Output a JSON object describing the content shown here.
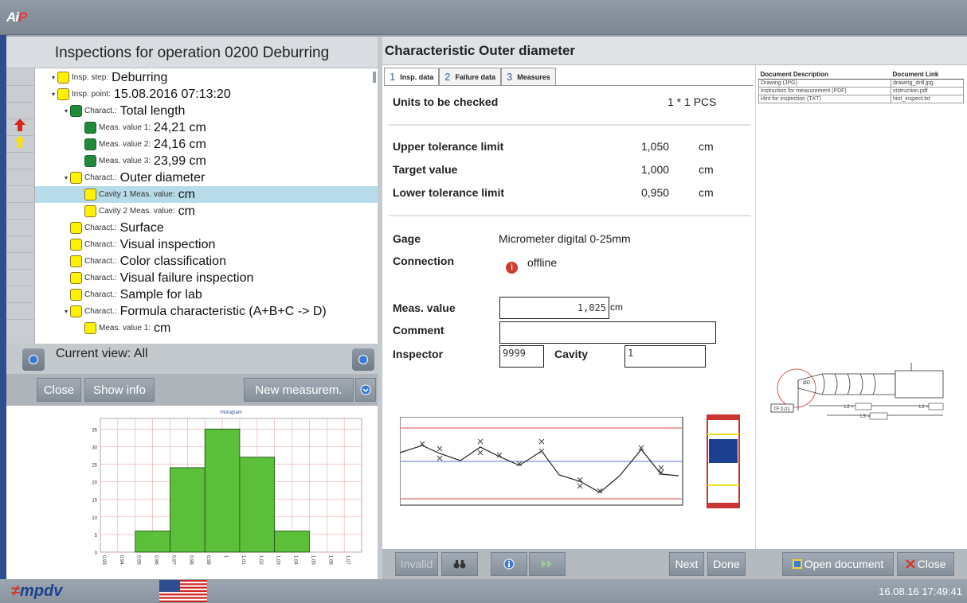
{
  "app": {
    "logo_a": "A",
    "logo_i": "i",
    "logo_p": "P"
  },
  "left": {
    "title": "Inspections for operation 0200 Deburring",
    "tree": [
      {
        "label": "Insp. step:",
        "value": "Deburring"
      },
      {
        "label": "Insp. point:",
        "value": "15.08.2016 07:13:20"
      },
      {
        "label": "Charact.:",
        "value": "Total length"
      },
      {
        "label": "Meas. value 1:",
        "value": "24,21 cm"
      },
      {
        "label": "Meas. value 2:",
        "value": "24,16 cm"
      },
      {
        "label": "Meas. value 3:",
        "value": "23,99 cm"
      },
      {
        "label": "Charact.:",
        "value": "Outer diameter"
      },
      {
        "label": "Cavity 1 Meas. value:",
        "value": "cm"
      },
      {
        "label": "Cavity 2 Meas. value:",
        "value": "cm"
      },
      {
        "label": "Charact.:",
        "value": "Surface"
      },
      {
        "label": "Charact.:",
        "value": "Visual inspection"
      },
      {
        "label": "Charact.:",
        "value": "Color classification"
      },
      {
        "label": "Charact.:",
        "value": "Visual failure inspection"
      },
      {
        "label": "Charact.:",
        "value": "Sample for lab"
      },
      {
        "label": "Charact.:",
        "value": "Formula characteristic (A+B+C -> D)"
      },
      {
        "label": "Meas. value 1:",
        "value": "cm"
      }
    ],
    "current_view": "Current view: All",
    "buttons": {
      "close": "Close",
      "show_info": "Show info",
      "new_measurement": "New measurem."
    }
  },
  "histogram": {
    "title": "Histogram"
  },
  "chart_data": {
    "type": "bar",
    "title": "Histogram",
    "categories": [
      "0,93",
      "0,94",
      "0,95",
      "0,96",
      "0,97",
      "0,98",
      "0,99",
      "1",
      "1,01",
      "1,02",
      "1,03",
      "1,04",
      "1,05",
      "1,06",
      "1,07"
    ],
    "values": [
      0,
      0,
      0,
      6,
      0,
      24,
      0,
      35,
      0,
      27,
      0,
      6,
      0,
      0,
      0
    ],
    "yticks": [
      "0",
      "5",
      "10",
      "15",
      "20",
      "25",
      "30",
      "35"
    ],
    "ylim": [
      0,
      38
    ],
    "grid": true,
    "bar_color": "#5bbf3a"
  },
  "right": {
    "title": "Characteristic Outer diameter",
    "tabs": [
      {
        "num": "1",
        "label": "Insp. data"
      },
      {
        "num": "2",
        "label": "Failure data"
      },
      {
        "num": "3",
        "label": "Measures"
      }
    ],
    "units_label": "Units to be checked",
    "units_value": "1 * 1 PCS",
    "limits": [
      {
        "label": "Upper tolerance limit",
        "value": "1,050",
        "unit": "cm"
      },
      {
        "label": "Target value",
        "value": "1,000",
        "unit": "cm"
      },
      {
        "label": "Lower tolerance limit",
        "value": "0,950",
        "unit": "cm"
      }
    ],
    "gage_label": "Gage",
    "gage_value": "Micrometer digital 0-25mm",
    "connection_label": "Connection",
    "connection_value": "offline",
    "meas_label": "Meas. value",
    "meas_value": "1,025",
    "meas_unit": "cm",
    "comment_label": "Comment",
    "comment_value": "",
    "inspector_label": "Inspector",
    "inspector_value": "9999",
    "cavity_label": "Cavity",
    "cavity_value": "1",
    "documents": {
      "headers": [
        "Document Description",
        "Document Link"
      ],
      "rows": [
        [
          "Drawing (JPG)",
          "drawing_drill.jpg"
        ],
        [
          "Instruction for measurement (PDF)",
          "instruction.pdf"
        ],
        [
          "Hint for inspection (TXT)",
          "hint_inspect.txt"
        ]
      ]
    },
    "drawing_labels": {
      "l2": "L2 =",
      "l3": "L3 =",
      "l1": "L1 =",
      "d": "ØD",
      "tr": "TF 0,01"
    }
  },
  "bottom": {
    "invalid": "Invalid",
    "next": "Next",
    "done": "Done",
    "open_document": "Open document",
    "close": "Close"
  },
  "footer": {
    "brand": "mpdv",
    "datetime": "16.08.16 17:49:41"
  },
  "colors": {
    "yellow_status": "#fff200",
    "green_status": "#1f8a3c",
    "selected_row": "#b8dbe9",
    "accent_blue": "#2d4d8f"
  }
}
